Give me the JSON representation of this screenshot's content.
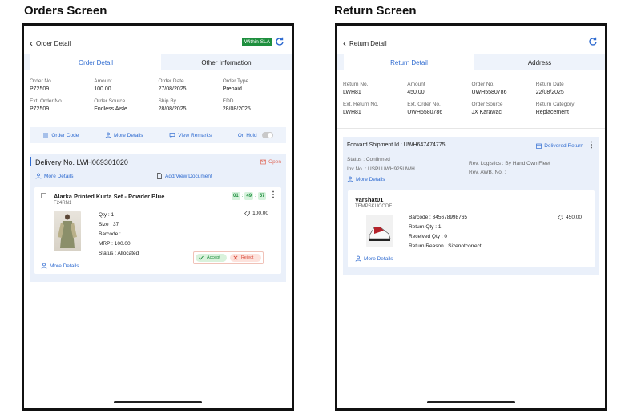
{
  "orders_screen": {
    "heading": "Orders Screen",
    "title": "Order Detail",
    "sla_badge": "Within SLA",
    "tabs": [
      "Order Detail",
      "Other Information"
    ],
    "fields": [
      {
        "label": "Order No.",
        "value": "P72509"
      },
      {
        "label": "Amount",
        "value": "100.00"
      },
      {
        "label": "Order Date",
        "value": "27/08/2025"
      },
      {
        "label": "Order Type",
        "value": "Prepaid"
      },
      {
        "label": "Ext. Order No.",
        "value": "P72509"
      },
      {
        "label": "Order Source",
        "value": "Endless Aisle"
      },
      {
        "label": "Ship By",
        "value": "28/08/2025"
      },
      {
        "label": "EDD",
        "value": "28/08/2025"
      }
    ],
    "actions": {
      "order_code": "Order Code",
      "more_details": "More Details",
      "view_remarks": "View Remarks",
      "on_hold": "On Hold"
    },
    "delivery": {
      "title": "Delivery No. LWH069301020",
      "status": "Open",
      "more_details": "More Details",
      "add_view_document": "Add/View Document"
    },
    "item": {
      "name": "Alarka Printed Kurta Set - Powder Blue",
      "sku": "F24RN1",
      "timer": [
        "01",
        "49",
        "57"
      ],
      "price": "100.00",
      "qty": "Qty : 1",
      "size": "Size : 37",
      "barcode": "Barcode :",
      "mrp": "MRP : 100.00",
      "status": "Status : Allocated",
      "more_details": "More Details",
      "accept": "Accept",
      "reject": "Reject"
    }
  },
  "return_screen": {
    "heading": "Return Screen",
    "title": "Return Detail",
    "tabs": [
      "Return Detail",
      "Address"
    ],
    "fields": [
      {
        "label": "Return No.",
        "value": "LWH81"
      },
      {
        "label": "Amount",
        "value": "450.00"
      },
      {
        "label": "Order No.",
        "value": "UWH5580786"
      },
      {
        "label": "Return Date",
        "value": "22/08/2025"
      },
      {
        "label": "Ext. Return No.",
        "value": "LWH81"
      },
      {
        "label": "Ext. Order No.",
        "value": "UWH5580786"
      },
      {
        "label": "Order Source",
        "value": "JX Karawaci"
      },
      {
        "label": "Return Category",
        "value": "Replacement"
      }
    ],
    "shipment": {
      "title": "Forward Shipment Id : UWH647474775",
      "status_badge": "Delivered Return",
      "status": "Status : Confirmed",
      "inv_no": "Inv No. : USPLUWH925UWH",
      "rev_logistics": "Rev. Logistics : By Hand Own Fleet",
      "rev_awb": "Rev. AWB. No. :",
      "more_details": "More Details"
    },
    "item": {
      "name": "Varshat01",
      "sku": "TEMPSKUCODE",
      "barcode": "Barcode : 345678998765",
      "price": "450.00",
      "return_qty": "Return Qty : 1",
      "received_qty": "Received Qty : 0",
      "return_reason": "Return Reason : Sizenotcorrect",
      "more_details": "More Details"
    }
  }
}
